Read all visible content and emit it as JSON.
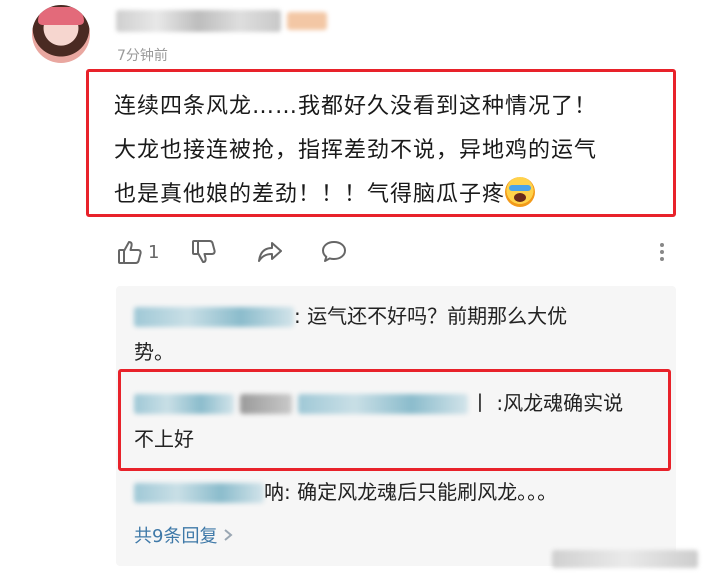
{
  "comment": {
    "time": "7分钟前",
    "lines": [
      "连续四条风龙……我都好久没看到这种情况了！",
      "大龙也接连被抢，指挥差劲不说，异地鸡的运气",
      "也是真他娘的差劲！！！气得脑瓜子疼"
    ],
    "emoji_icon": "crying-face-emoji",
    "like_count": "1"
  },
  "icons": {
    "like": "thumbs-up-icon",
    "dislike": "thumbs-down-icon",
    "share": "share-arrow-icon",
    "reply": "speech-bubble-icon",
    "more": "vertical-dots-icon"
  },
  "replies": [
    {
      "text_line1": ": 运气还不好吗？前期那么大优",
      "text_line2": "势。"
    },
    {
      "text_line1": "丨 :风龙魂确实说",
      "text_line2": "不上好"
    },
    {
      "text_line1": "呐: 确定风龙魂后只能刷风龙。。。"
    }
  ],
  "more_replies_label": "共9条回复",
  "colors": {
    "highlight_box": "#e8222a",
    "link": "#3f79a8",
    "reply_bg": "#f6f6f6"
  }
}
